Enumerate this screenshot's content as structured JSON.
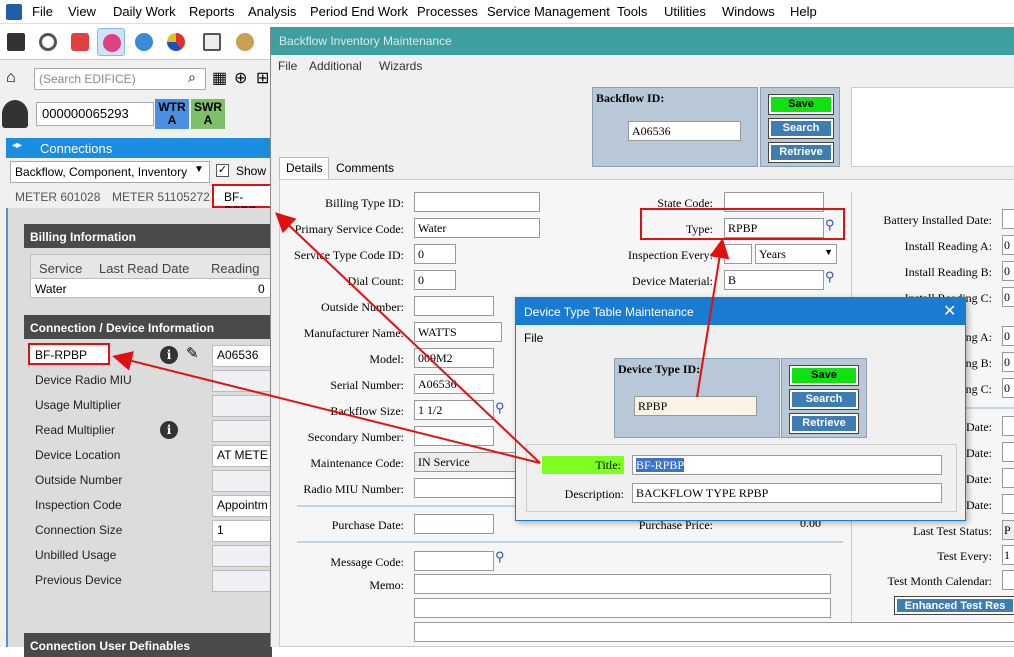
{
  "menubar": [
    "File",
    "View",
    "Daily Work",
    "Reports",
    "Analysis",
    "Period End Work",
    "Processes",
    "Service Management",
    "Tools",
    "Utilities",
    "Windows",
    "Help"
  ],
  "left": {
    "search_placeholder": "(Search EDIFICE)",
    "account_number": "000000065293",
    "badges": [
      {
        "text": "WTR A",
        "color": "#4b8fe0"
      },
      {
        "text": "SWR A",
        "color": "#7fbf6a"
      }
    ],
    "connections_tab": "Connections",
    "combo_value": "Backflow, Component, Inventory",
    "show_label": "Show m",
    "meter_tabs": [
      "METER 601028",
      "METER 51105272",
      "BF-RPBP"
    ],
    "billing_header": "Billing Information",
    "billing_columns": [
      "Service",
      "Last Read Date",
      "Reading"
    ],
    "billing_rows": [
      [
        "Water",
        "",
        "0"
      ]
    ],
    "connection_header": "Connection / Device Information",
    "device_id": "BF-RPBP",
    "device_value": "A06536",
    "fields": [
      {
        "label": "Device Radio MIU",
        "value": ""
      },
      {
        "label": "Usage Multiplier",
        "value": ""
      },
      {
        "label": "Read Multiplier",
        "value": ""
      },
      {
        "label": "Device Location",
        "value": "AT METE"
      },
      {
        "label": "Outside Number",
        "value": ""
      },
      {
        "label": "Inspection Code",
        "value": "Appointm"
      },
      {
        "label": "Connection Size",
        "value": "1"
      },
      {
        "label": "Unbilled Usage",
        "value": ""
      },
      {
        "label": "Previous Device",
        "value": ""
      }
    ],
    "user_definables_header": "Connection User Definables"
  },
  "main": {
    "title": "Backflow Inventory Maintenance",
    "menu": [
      "File",
      "Additional",
      "Wizards"
    ],
    "backflow_id_label": "Backflow ID:",
    "backflow_id": "A06536",
    "buttons": {
      "save": "Save",
      "search": "Search",
      "retrieve": "Retrieve"
    },
    "tabs": [
      "Details",
      "Comments"
    ],
    "left_fields": [
      {
        "label": "Billing Type ID:",
        "value": ""
      },
      {
        "label": "Primary Service Code:",
        "value": "Water"
      },
      {
        "label": "Service Type Code ID:",
        "value": "0"
      },
      {
        "label": "Dial Count:",
        "value": "0"
      },
      {
        "label": "Outside Number:",
        "value": ""
      },
      {
        "label": "Manufacturer Name:",
        "value": "WATTS"
      },
      {
        "label": "Model:",
        "value": "009M2"
      },
      {
        "label": "Serial Number:",
        "value": "A06536"
      },
      {
        "label": "Backflow Size:",
        "value": "1 1/2"
      },
      {
        "label": "Secondary Number:",
        "value": ""
      },
      {
        "label": "Maintenance Code:",
        "value": "IN Service"
      },
      {
        "label": "Radio MIU Number:",
        "value": ""
      }
    ],
    "purchase_date_label": "Purchase Date:",
    "message_code_label": "Message Code:",
    "memo_label": "Memo:",
    "state_code_label": "State Code:",
    "type_label": "Type:",
    "type_value": "RPBP",
    "inspection_every_label": "Inspection Every:",
    "inspection_unit": "Years",
    "device_material_label": "Device Material:",
    "device_material_value": "B",
    "purchase_price_label": "Purchase Price:",
    "purchase_price_value": "0.00",
    "right_fields": [
      {
        "label": "Battery Installed Date:",
        "value": ""
      },
      {
        "label": "Install Reading A:",
        "value": "0"
      },
      {
        "label": "Install Reading B:",
        "value": "0"
      },
      {
        "label": "Install Reading C:",
        "value": "0"
      },
      {
        "label": "Reading A:",
        "value": "0"
      },
      {
        "label": "Reading B:",
        "value": "0"
      },
      {
        "label": "Reading C:",
        "value": "0"
      },
      {
        "label": "Date:",
        "value": ""
      },
      {
        "label": "Date:",
        "value": ""
      },
      {
        "label": "Date:",
        "value": ""
      },
      {
        "label": "Date:",
        "value": ""
      },
      {
        "label": "Last Test Status:",
        "value": "P"
      },
      {
        "label": "Test Every:",
        "value": "1"
      },
      {
        "label": "Test Month Calendar:",
        "value": ""
      }
    ],
    "enhanced_button": "Enhanced Test Res"
  },
  "dialog": {
    "title": "Device Type Table Maintenance",
    "menu": "File",
    "id_label": "Device Type ID:",
    "id_value": "RPBP",
    "buttons": {
      "save": "Save",
      "search": "Search",
      "retrieve": "Retrieve"
    },
    "title_label": "Title:",
    "title_value": "BF-RPBP",
    "description_label": "Description:",
    "description_value": "BACKFLOW TYPE RPBP"
  },
  "colors": {
    "accent": "#1a8de0",
    "teal_title": "#3e9fa0",
    "highlight": "#e01010",
    "save_green": "#11e011"
  }
}
